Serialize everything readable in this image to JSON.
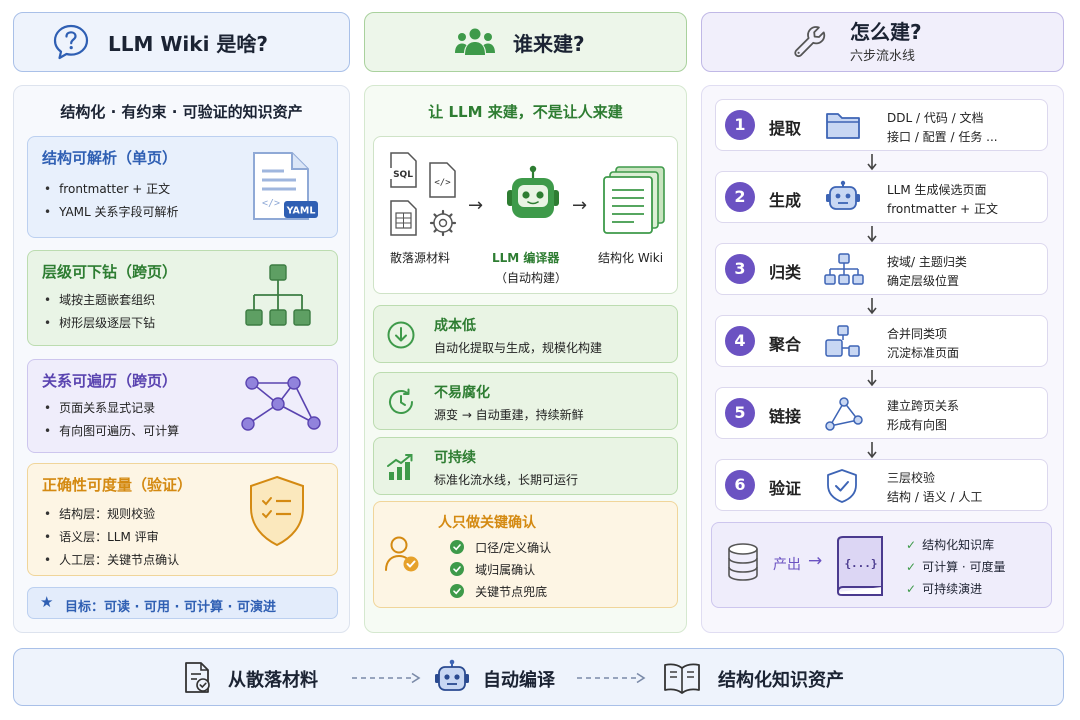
{
  "headers": {
    "col1": "LLM Wiki 是啥?",
    "col2": "谁来建?",
    "col3": "怎么建?",
    "col3_sub": "六步流水线"
  },
  "col1": {
    "title": "结构化 · 有约束 · 可验证的知识资产",
    "cards": [
      {
        "title": "结构可解析（单页）",
        "items": [
          "frontmatter + 正文",
          "YAML 关系字段可解析"
        ],
        "badge": "YAML"
      },
      {
        "title": "层级可下钻（跨页）",
        "items": [
          "域按主题嵌套组织",
          "树形层级逐层下钻"
        ]
      },
      {
        "title": "关系可遍历（跨页）",
        "items": [
          "页面关系显式记录",
          "有向图可遍历、可计算"
        ]
      },
      {
        "title": "正确性可度量（验证）",
        "items": [
          "结构层：规则校验",
          "语义层：LLM 评审",
          "人工层：关键节点确认"
        ]
      }
    ],
    "goal": "目标：可读 · 可用 · 可计算 · 可演进"
  },
  "col2": {
    "title": "让 LLM 来建，不是让人来建",
    "sql_label": "SQL",
    "source_label": "散落源材料",
    "compiler_label": "LLM 编译器",
    "compiler_sub": "（自动构建）",
    "output_label": "结构化 Wiki",
    "benefits": [
      {
        "title": "成本低",
        "desc": "自动化提取与生成，规模化构建"
      },
      {
        "title": "不易腐化",
        "desc": "源变 → 自动重建，持续新鲜"
      },
      {
        "title": "可持续",
        "desc": "标准化流水线，长期可运行"
      }
    ],
    "human": {
      "title": "人只做关键确认",
      "items": [
        "口径/定义确认",
        "域归属确认",
        "关键节点兜底"
      ]
    }
  },
  "col3": {
    "steps": [
      {
        "num": "1",
        "name": "提取",
        "d1": "DDL / 代码 / 文档",
        "d2": "接口 / 配置 / 任务 ..."
      },
      {
        "num": "2",
        "name": "生成",
        "d1": "LLM 生成候选页面",
        "d2": "frontmatter + 正文"
      },
      {
        "num": "3",
        "name": "归类",
        "d1": "按域/ 主题归类",
        "d2": "确定层级位置"
      },
      {
        "num": "4",
        "name": "聚合",
        "d1": "合并同类项",
        "d2": "沉淀标准页面"
      },
      {
        "num": "5",
        "name": "链接",
        "d1": "建立跨页关系",
        "d2": "形成有向图"
      },
      {
        "num": "6",
        "name": "验证",
        "d1": "三层校验",
        "d2": "结构 / 语义 / 人工"
      }
    ],
    "output": {
      "label": "产出",
      "book": "{...}",
      "items": [
        "结构化知识库",
        "可计算 · 可度量",
        "可持续演进"
      ]
    }
  },
  "bottom": {
    "from": "从散落材料",
    "mid": "自动编译",
    "to": "结构化知识资产"
  },
  "colors": {
    "blue": "#2f5fb3",
    "green": "#2e7d32",
    "purple": "#6b52c2",
    "orange": "#d48a12"
  }
}
